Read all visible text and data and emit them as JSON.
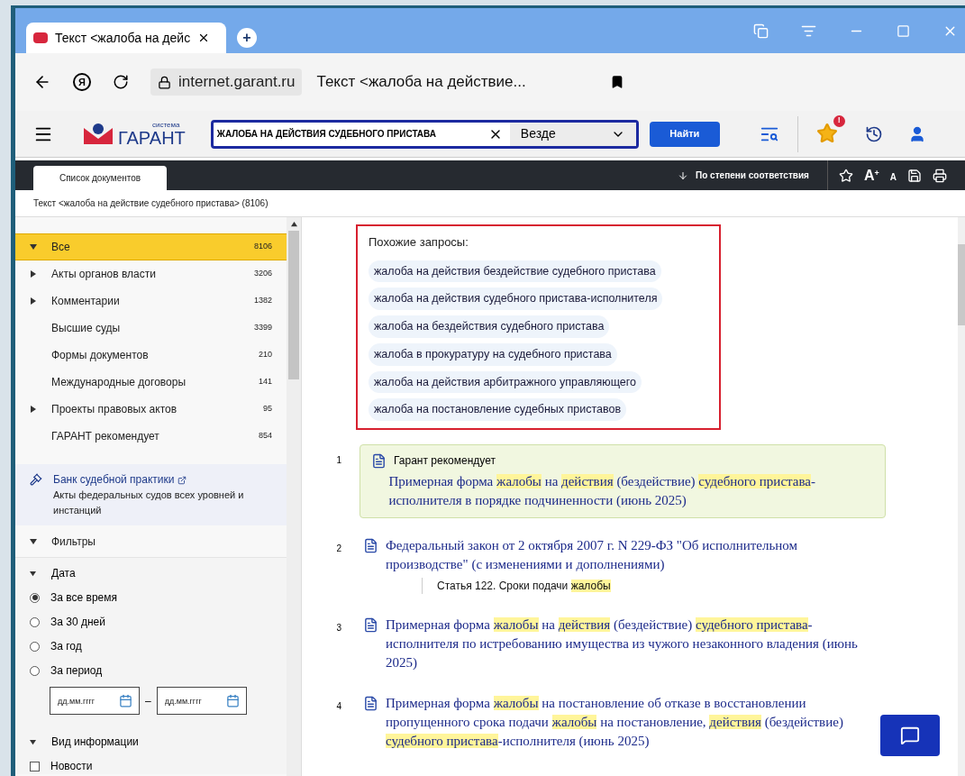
{
  "browser": {
    "tab_title": "Текст <жалоба на дейс",
    "new_tab": "+",
    "yandex": "Я",
    "address": "internet.garant.ru",
    "page_title": "Текст <жалоба на действие..."
  },
  "header": {
    "logo_small": "система",
    "logo_big": "ГАРАНТ",
    "search_value": "ЖАЛОБА НА ДЕЙСТВИЯ СУДЕБНОГО ПРИСТАВА",
    "scope": "Везде",
    "search_button": "Найти",
    "notification": "!"
  },
  "toolbar": {
    "tab": "Список документов",
    "sort": "По степени соответствия",
    "font_up": "A",
    "font_up_sup": "+",
    "font_down": "A"
  },
  "breadcrumb": "Текст <жалоба на действие судебного пристава> (8106)",
  "categories": [
    {
      "label": "Все",
      "count": "8106",
      "expandable": true,
      "expanded": true,
      "selected": true
    },
    {
      "label": "Акты органов власти",
      "count": "3206",
      "expandable": true,
      "expanded": false,
      "selected": false
    },
    {
      "label": "Комментарии",
      "count": "1382",
      "expandable": true,
      "expanded": false,
      "selected": false
    },
    {
      "label": "Высшие суды",
      "count": "3399",
      "expandable": false,
      "selected": false
    },
    {
      "label": "Формы документов",
      "count": "210",
      "expandable": false,
      "selected": false
    },
    {
      "label": "Международные договоры",
      "count": "141",
      "expandable": false,
      "selected": false
    },
    {
      "label": "Проекты правовых актов",
      "count": "95",
      "expandable": true,
      "expanded": false,
      "selected": false
    },
    {
      "label": "ГАРАНТ рекомендует",
      "count": "854",
      "expandable": false,
      "selected": false
    }
  ],
  "bank": {
    "title": "Банк судебной практики",
    "subtitle": "Акты федеральных судов всех уровней и инстанций"
  },
  "filters": {
    "title": "Фильтры",
    "date_title": "Дата",
    "date_options": [
      {
        "label": "За все время",
        "selected": true
      },
      {
        "label": "За 30 дней",
        "selected": false
      },
      {
        "label": "За год",
        "selected": false
      },
      {
        "label": "За период",
        "selected": false
      }
    ],
    "date_from": {
      "placeholder": "дд.мм.гггг"
    },
    "dash": "–",
    "date_to": {
      "placeholder": "дд.мм.гггг"
    },
    "info_title": "Вид информации",
    "info_options": [
      {
        "label": "Новости",
        "checked": false
      }
    ]
  },
  "similar": {
    "title": "Похожие запросы:",
    "items": [
      "жалоба на действия бездействие судебного пристава",
      "жалоба на действия судебного пристава-исполнителя",
      "жалоба на бездействия судебного пристава",
      "жалоба в прокуратуру на судебного пристава",
      "жалоба на действия арбитражного управляющего",
      "жалоба на постановление судебных приставов"
    ]
  },
  "results": [
    {
      "number": "1",
      "kind": "recommended",
      "label": "Гарант рекомендует",
      "title": [
        {
          "text": "Примерная форма ",
          "highlight": false
        },
        {
          "text": "жалобы",
          "highlight": true
        },
        {
          "text": " на ",
          "highlight": false
        },
        {
          "text": "действия",
          "highlight": true
        },
        {
          "text": " (бездействие) ",
          "highlight": false
        },
        {
          "text": "судебного пристава",
          "highlight": true
        },
        {
          "text": "-исполнителя в порядке подчиненности (июнь 2025)",
          "highlight": false
        }
      ]
    },
    {
      "number": "2",
      "kind": "plain",
      "title": [
        {
          "text": "Федеральный закон от 2 октября 2007 г. N 229-ФЗ \"Об исполнительном производстве\" (с изменениями и дополнениями)",
          "highlight": false
        }
      ],
      "subitem": [
        {
          "text": "Статья 122. Сроки подачи ",
          "highlight": false
        },
        {
          "text": "жалобы",
          "highlight": true
        }
      ]
    },
    {
      "number": "3",
      "kind": "plain",
      "title": [
        {
          "text": "Примерная форма ",
          "highlight": false
        },
        {
          "text": "жалобы",
          "highlight": true
        },
        {
          "text": " на ",
          "highlight": false
        },
        {
          "text": "действия",
          "highlight": true
        },
        {
          "text": " (бездействие) ",
          "highlight": false
        },
        {
          "text": "судебного пристава",
          "highlight": true
        },
        {
          "text": "-исполнителя по истребованию имущества из чужого незаконного владения (июнь 2025)",
          "highlight": false
        }
      ]
    },
    {
      "number": "4",
      "kind": "plain",
      "title": [
        {
          "text": "Примерная форма ",
          "highlight": false
        },
        {
          "text": "жалобы",
          "highlight": true
        },
        {
          "text": " на постановление об отказе в восстановлении пропущенного срока подачи ",
          "highlight": false
        },
        {
          "text": "жалобы",
          "highlight": true
        },
        {
          "text": " на постановление, ",
          "highlight": false
        },
        {
          "text": "действия",
          "highlight": true
        },
        {
          "text": " (бездействие) ",
          "highlight": false
        },
        {
          "text": "судебного пристава",
          "highlight": true
        },
        {
          "text": "-исполнителя (июнь 2025)",
          "highlight": false
        }
      ]
    }
  ]
}
